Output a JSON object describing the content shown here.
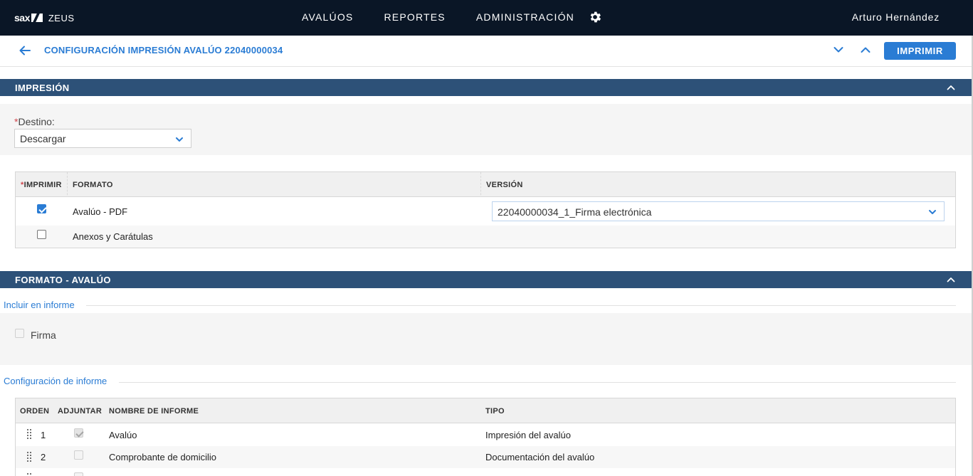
{
  "app": {
    "brand": "sax",
    "product": "ZEUS"
  },
  "nav": {
    "items": [
      "AVALÚOS",
      "REPORTES",
      "ADMINISTRACIÓN"
    ],
    "settings_icon": "gear-icon"
  },
  "user": {
    "name": "Arturo Hernández"
  },
  "page": {
    "title": "CONFIGURACIÓN IMPRESIÓN AVALÚO 22040000034",
    "print_label": "IMPRIMIR"
  },
  "impresion": {
    "title": "IMPRESIÓN",
    "destino_required": "*",
    "destino_label": "Destino:",
    "destino_value": "Descargar",
    "table": {
      "headers": {
        "required": "*",
        "imprimir": "IMPRIMIR",
        "formato": "FORMATO",
        "version": "VERSIÓN"
      },
      "rows": [
        {
          "checked": true,
          "formato": "Avalúo - PDF",
          "version": "22040000034_1_Firma electrónica"
        },
        {
          "checked": false,
          "formato": "Anexos y Carátulas",
          "version": ""
        }
      ]
    }
  },
  "formato_avaluo": {
    "title": "FORMATO - AVALÚO",
    "incluir_label": "Incluir en informe",
    "firma_label": "Firma",
    "config_label": "Configuración de informe",
    "table": {
      "headers": {
        "orden": "ORDEN",
        "adjuntar": "ADJUNTAR",
        "nombre": "NOMBRE DE INFORME",
        "tipo": "TIPO"
      },
      "rows": [
        {
          "orden": "1",
          "adjuntar": true,
          "nombre": "Avalúo",
          "tipo": "Impresión del avalúo"
        },
        {
          "orden": "2",
          "adjuntar": false,
          "nombre": "Comprobante de domicilio",
          "tipo": "Documentación del avalúo"
        }
      ]
    }
  },
  "colors": {
    "topbar": "#0a1626",
    "accent": "#2a7cd4",
    "section": "#2d5178",
    "required": "#d0454c"
  }
}
